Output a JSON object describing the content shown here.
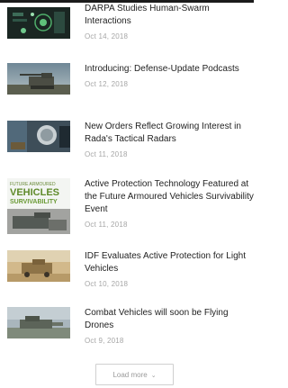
{
  "articles": [
    {
      "title": "DARPA Studies Human-Swarm Interactions",
      "date": "Oct 14, 2018",
      "thumb": "swarm-interface"
    },
    {
      "title": "Introducing: Defense-Update Podcasts",
      "date": "Oct 12, 2018",
      "thumb": "tank-sky"
    },
    {
      "title": "New Orders Reflect Growing Interest in Rada's Tactical Radars",
      "date": "Oct 11, 2018",
      "thumb": "radar-panel"
    },
    {
      "title": "Active Protection Technology Featured at the Future Armoured Vehicles Survivability Event",
      "date": "Oct 11, 2018",
      "thumb": "fav-survivability-banner",
      "thumb_text": [
        "FUTURE ARMOURED",
        "VEHICLES",
        "SURVIVABILITY"
      ]
    },
    {
      "title": "IDF Evaluates Active Protection for Light Vehicles",
      "date": "Oct 10, 2018",
      "thumb": "light-vehicle-desert"
    },
    {
      "title": "Combat Vehicles will soon be Flying Drones",
      "date": "Oct 9, 2018",
      "thumb": "combat-vehicle-drone"
    }
  ],
  "load_more": {
    "label": "Load more",
    "icon": "chevron-down-icon"
  }
}
